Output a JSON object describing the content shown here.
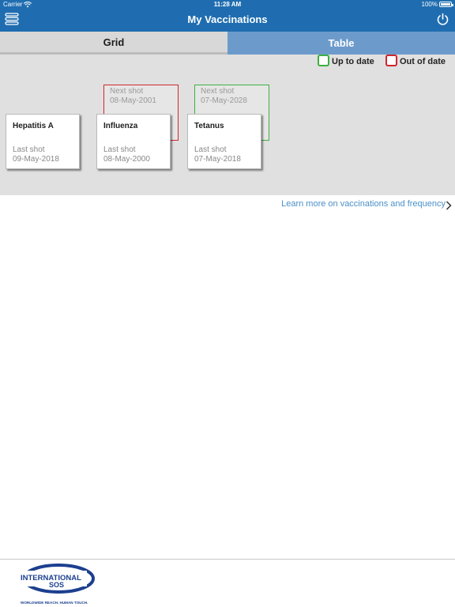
{
  "status_bar": {
    "carrier": "Carrier",
    "time": "11:28 AM",
    "battery": "100%"
  },
  "nav": {
    "title": "My Vaccinations",
    "left_icon": "menu-icon",
    "right_icon": "power-icon"
  },
  "tabs": [
    {
      "label": "Grid",
      "selected": true
    },
    {
      "label": "Table",
      "selected": false
    }
  ],
  "legend": {
    "up_to_date": {
      "label": "Up to date",
      "color": "#3cb043"
    },
    "out_of_date": {
      "label": "Out of date",
      "color": "#d0262c"
    }
  },
  "vaccines": [
    {
      "name": "Hepatitis A",
      "last_label": "Last shot",
      "last_date": "09-May-2018"
    },
    {
      "name": "Influenza",
      "last_label": "Last shot",
      "last_date": "08-May-2000",
      "next_label": "Next shot",
      "next_date": "08-May-2001",
      "status": "out_of_date"
    },
    {
      "name": "Tetanus",
      "last_label": "Last shot",
      "last_date": "07-May-2018",
      "next_label": "Next shot",
      "next_date": "07-May-2028",
      "status": "up_to_date"
    }
  ],
  "learn_more": {
    "label": "Learn more on vaccinations and frequency"
  },
  "footer": {
    "logo_line1": "INTERNATIONAL",
    "logo_line2": "SOS",
    "tagline": "WORLDWIDE REACH. HUMAN TOUCH."
  },
  "colors": {
    "nav_bar": "#1f6db0",
    "tab_selected": "#d8d8d8",
    "tab_unselected": "#6c9bcb",
    "grid_bg": "#e0e0e0",
    "link": "#4a90c9"
  }
}
